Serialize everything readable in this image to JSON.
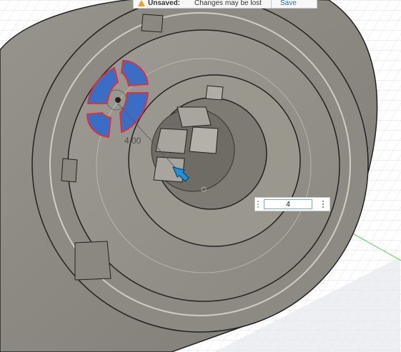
{
  "notification": {
    "status_label": "Unsaved:",
    "message": "Changes may be lost",
    "save_label": "Save",
    "icon": "warning-icon"
  },
  "sketch_dimension": {
    "label": "4.00",
    "input_value": "4"
  },
  "colors": {
    "body_gray": "#8f8c85",
    "selection_blue": "#3a6ec4",
    "selection_outline": "#e0303a",
    "grid_line": "#d8dce2",
    "axis_green": "#4fc94f",
    "cursor_blue": "#1e90d6"
  }
}
